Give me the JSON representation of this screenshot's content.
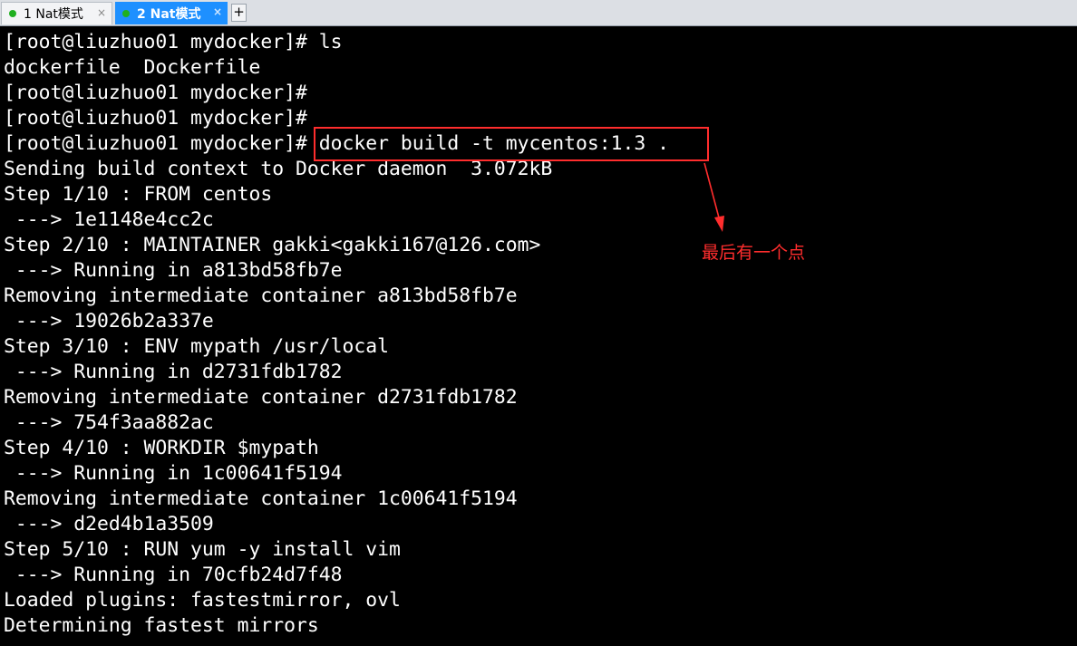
{
  "tabs": [
    {
      "label": "1 Nat模式",
      "close": "×",
      "dot_color": "#20b020"
    },
    {
      "label": "2 Nat模式",
      "close": "×",
      "dot_color": "#20b020"
    }
  ],
  "add_tab": "+",
  "terminal": {
    "lines": [
      "[root@liuzhuo01 mydocker]# ls",
      "dockerfile  Dockerfile",
      "[root@liuzhuo01 mydocker]#",
      "[root@liuzhuo01 mydocker]#",
      "[root@liuzhuo01 mydocker]# docker build -t mycentos:1.3 .",
      "Sending build context to Docker daemon  3.072kB",
      "Step 1/10 : FROM centos",
      " ---> 1e1148e4cc2c",
      "Step 2/10 : MAINTAINER gakki<gakki167@126.com>",
      " ---> Running in a813bd58fb7e",
      "Removing intermediate container a813bd58fb7e",
      " ---> 19026b2a337e",
      "Step 3/10 : ENV mypath /usr/local",
      " ---> Running in d2731fdb1782",
      "Removing intermediate container d2731fdb1782",
      " ---> 754f3aa882ac",
      "Step 4/10 : WORKDIR $mypath",
      " ---> Running in 1c00641f5194",
      "Removing intermediate container 1c00641f5194",
      " ---> d2ed4b1a3509",
      "Step 5/10 : RUN yum -y install vim",
      " ---> Running in 70cfb24d7f48",
      "Loaded plugins: fastestmirror, ovl",
      "Determining fastest mirrors"
    ]
  },
  "annotation": {
    "text": "最后有一个点",
    "color": "#ff2d2d"
  },
  "colors": {
    "terminal_bg": "#000000",
    "terminal_fg": "#ffffff",
    "active_tab": "#1e90ff"
  }
}
